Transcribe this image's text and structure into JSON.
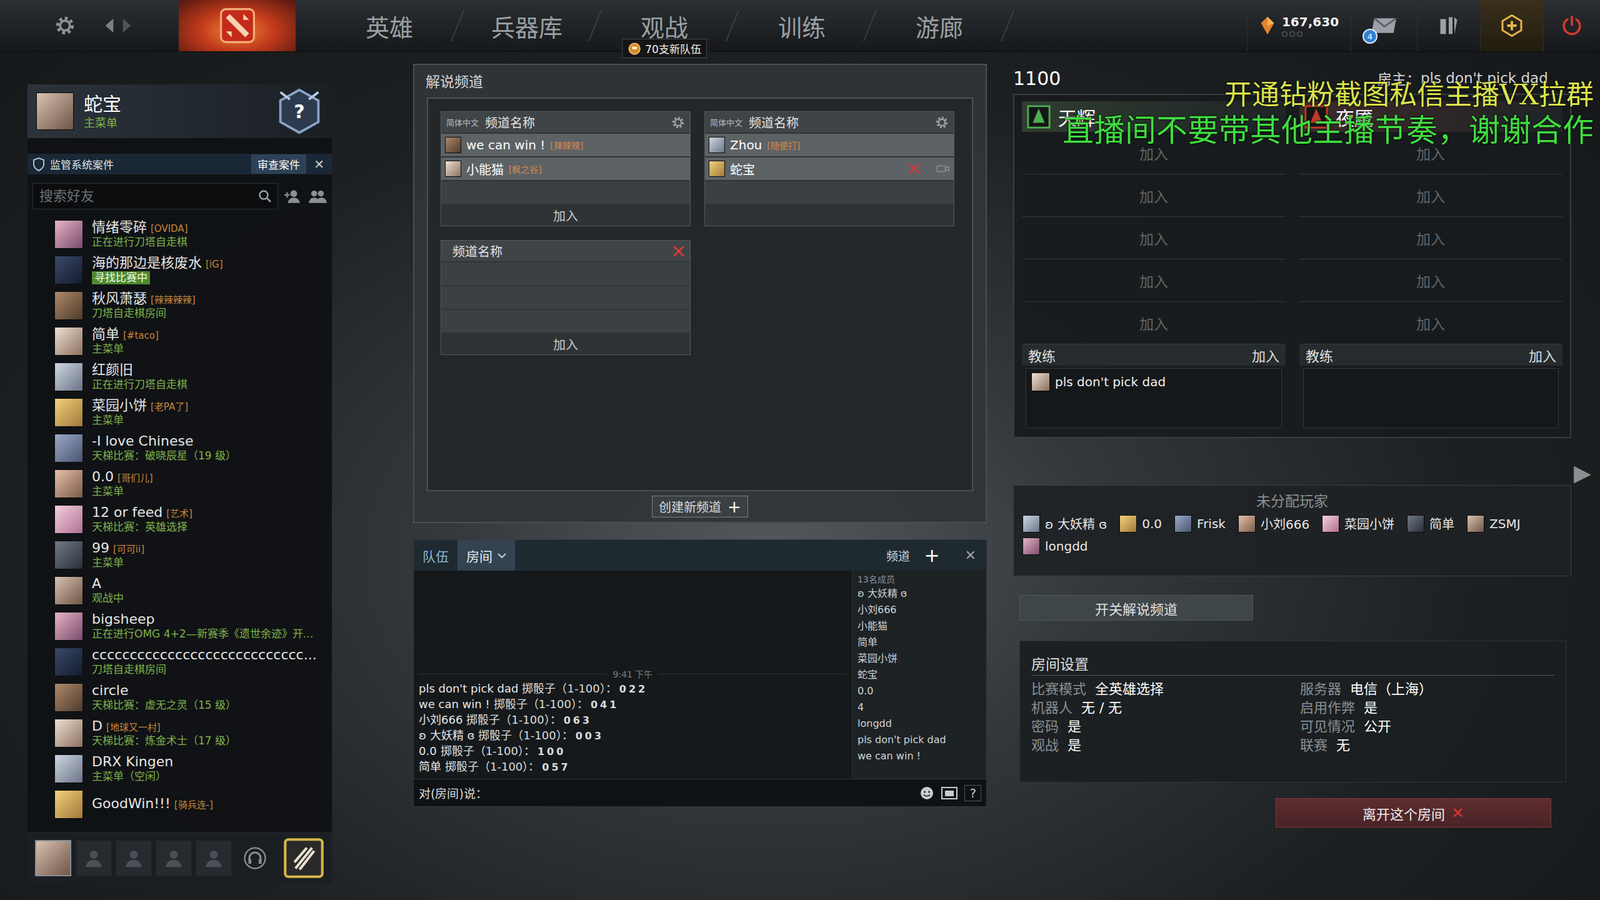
{
  "topbar": {
    "nav": [
      {
        "label": "英雄",
        "selected": false
      },
      {
        "label": "兵器库",
        "selected": false
      },
      {
        "label": "观战",
        "selected": false
      },
      {
        "label": "训练",
        "selected": false
      },
      {
        "label": "游廊",
        "selected": false
      }
    ],
    "notice": "70支新队伍",
    "currency": "167,630",
    "mail_count": "4"
  },
  "profile": {
    "name": "蛇宝",
    "status": "主菜单",
    "rank": "?"
  },
  "case_bar": {
    "label": "监管系统案件",
    "button": "审查案件",
    "close": "✕"
  },
  "friends_search": {
    "placeholder": "搜索好友"
  },
  "friends": [
    {
      "name": "情绪零碎",
      "tag": "[OVIDA]",
      "status": "正在进行刀塔自走棋",
      "highlight": false
    },
    {
      "name": "海的那边是核废水",
      "tag": "[iG]",
      "status": "寻找比赛中",
      "highlight": true
    },
    {
      "name": "秋风萧瑟",
      "tag": "[辣辣辣辣]",
      "status": "刀塔自走棋房间",
      "highlight": false
    },
    {
      "name": "简单",
      "tag": "[#taco]",
      "status": "主菜单",
      "highlight": false
    },
    {
      "name": "红颜旧",
      "status": "正在进行刀塔自走棋",
      "highlight": false
    },
    {
      "name": "菜园小饼",
      "tag": "[老PA了]",
      "status": "主菜单",
      "highlight": false
    },
    {
      "name": "-I love Chinese",
      "status": "天梯比赛：破晓辰星（19 级）",
      "highlight": false
    },
    {
      "name": "0.0",
      "tag": "[哥们儿]",
      "status": "主菜单",
      "highlight": false
    },
    {
      "name": "12 or feed",
      "tag": "[艺术]",
      "status": "天梯比赛：英雄选择",
      "highlight": false
    },
    {
      "name": "99",
      "tag": "[可可ii]",
      "status": "主菜单",
      "highlight": false
    },
    {
      "name": "A",
      "status": "观战中",
      "highlight": false
    },
    {
      "name": "bigsheep",
      "status": "正在进行OMG 4+2—新赛季《遗世余迹》开…",
      "highlight": false
    },
    {
      "name": "cccccccccccccccccccccccccccc...",
      "status": "刀塔自走棋房间",
      "highlight": false
    },
    {
      "name": "circle",
      "status": "天梯比赛：虚无之灵（15 级）",
      "highlight": false
    },
    {
      "name": "D",
      "tag": "[地球又一村]",
      "status": "天梯比赛：炼金术士（17 级）",
      "highlight": false
    },
    {
      "name": "DRX Kingen",
      "status": "主菜单（空闲）",
      "highlight": false
    },
    {
      "name": "GoodWin!!!",
      "tag": "[骑兵连-]",
      "highlight": false
    }
  ],
  "broadcast": {
    "title": "解说频道",
    "channels": [
      {
        "language": "简体中文",
        "name": "频道名称",
        "removable": false,
        "join": "加入",
        "members": [
          {
            "name": "we can win !",
            "tag": "[辣辣辣]",
            "self": false
          },
          {
            "name": "小能猫",
            "tag": "[枫之谷]",
            "self": false
          }
        ]
      },
      {
        "language": "简体中文",
        "name": "频道名称",
        "removable": false,
        "members": [
          {
            "name": "Zhou",
            "tag": "[随便打]",
            "self": false
          },
          {
            "name": "蛇宝",
            "self": true
          }
        ]
      },
      {
        "name": "频道名称",
        "removable": true,
        "join": "加入",
        "members": []
      }
    ],
    "create_button": "创建新频道",
    "create_icon": "+"
  },
  "chat": {
    "tabs": [
      {
        "label": "队伍",
        "selected": false
      },
      {
        "label": "房间",
        "selected": true
      }
    ],
    "channel_label": "频道",
    "add": "+",
    "close": "✕",
    "timestamp": "9:41 下午",
    "messages": [
      {
        "user": "pls don't pick dad",
        "text": "掷骰子（1-100）：",
        "roll": "022"
      },
      {
        "user": "we can win !",
        "text": "掷骰子（1-100）：",
        "roll": "041"
      },
      {
        "user": "小刘666",
        "text": "掷骰子（1-100）：",
        "roll": "063"
      },
      {
        "user": "ʚ 大妖精 ɞ",
        "text": "掷骰子（1-100）：",
        "roll": "003"
      },
      {
        "user": "0.0",
        "text": "掷骰子（1-100）：",
        "roll": "100"
      },
      {
        "user": "简单",
        "text": "掷骰子（1-100）：",
        "roll": "057"
      }
    ],
    "input_label": "对(房间)说：",
    "help": "?",
    "member_count": "13名成员",
    "members": [
      "ʚ 大妖精 ɞ",
      "小刘666",
      "小能猫",
      "简单",
      "菜园小饼",
      "蛇宝",
      "0.0",
      "4",
      "longdd",
      "pls don't pick dad",
      "we can win !"
    ]
  },
  "lobby": {
    "name": "1100",
    "host_label": "房主：",
    "host": "pls don't pick dad",
    "teams": [
      {
        "name": "天辉",
        "color": "#4caf50",
        "slots": [
          "加入",
          "加入",
          "加入",
          "加入",
          "加入"
        ],
        "coach_label": "教练",
        "coach_join": "加入",
        "coaches": [
          "pls don't pick dad"
        ]
      },
      {
        "name": "夜魇",
        "color": "#c0392b",
        "slots": [
          "加入",
          "加入",
          "加入",
          "加入",
          "加入"
        ],
        "coach_label": "教练",
        "coach_join": "加入",
        "coaches": []
      }
    ],
    "unassigned_title": "未分配玩家",
    "unassigned": [
      "ʚ 大妖精 ɞ",
      "0.0",
      "Frisk",
      "小刘666",
      "菜园小饼",
      "简单",
      "ZSMJ",
      "longdd"
    ],
    "broadcast_toggle": "开关解说频道",
    "settings_title": "房间设置",
    "settings": [
      {
        "label": "比赛模式",
        "value": "全英雄选择"
      },
      {
        "label": "机器人",
        "value": "无 / 无"
      },
      {
        "label": "密码",
        "value": "是"
      },
      {
        "label": "观战",
        "value": "是"
      },
      {
        "label": "服务器",
        "value": "电信（上海）"
      },
      {
        "label": "启用作弊",
        "value": "是"
      },
      {
        "label": "可见情况",
        "value": "公开"
      },
      {
        "label": "联赛",
        "value": "无"
      }
    ],
    "leave": "离开这个房间",
    "leave_icon": "✕"
  },
  "side_arrow": "▶",
  "overlay": {
    "lines": [
      "开通钻粉截图私信主播VX拉群",
      "直播间不要带其他主播节奏，谢谢合作"
    ]
  }
}
